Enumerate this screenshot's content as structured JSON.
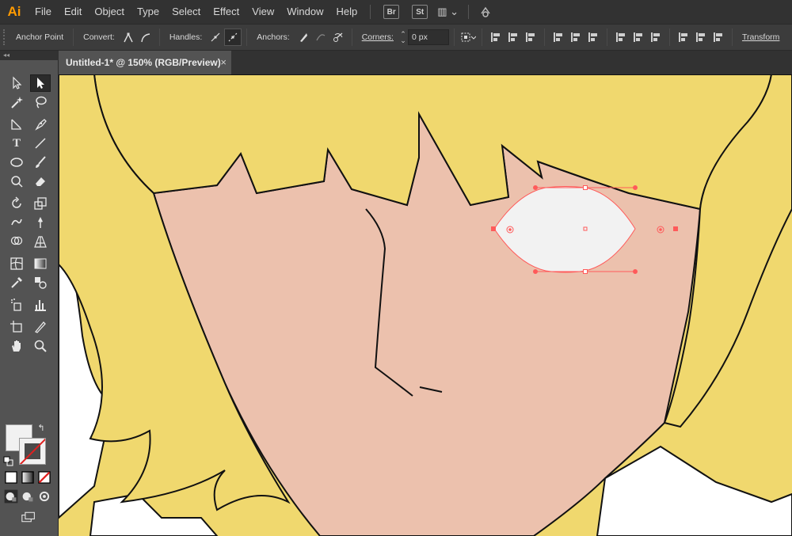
{
  "app": {
    "logo": "Ai"
  },
  "menu": {
    "items": [
      "File",
      "Edit",
      "Object",
      "Type",
      "Select",
      "Effect",
      "View",
      "Window",
      "Help"
    ],
    "bridge": "Br",
    "stock": "St"
  },
  "control_bar": {
    "anchor_point": "Anchor Point",
    "convert": "Convert:",
    "handles": "Handles:",
    "anchors": "Anchors:",
    "corners": "Corners:",
    "corners_value": "0 px",
    "transform": "Transform"
  },
  "document": {
    "tab_title": "Untitled-1* @ 150% (RGB/Preview)",
    "close_glyph": "×"
  },
  "toolbar": {
    "collapse_glyph": "◂◂",
    "swap_glyph": "↰"
  },
  "colors": {
    "hair": "#f0d86e",
    "skin": "#ecc1ad",
    "eye": "#f2f2f2",
    "selection": "#ff5a5a",
    "accent_logo": "#ff9a00"
  }
}
